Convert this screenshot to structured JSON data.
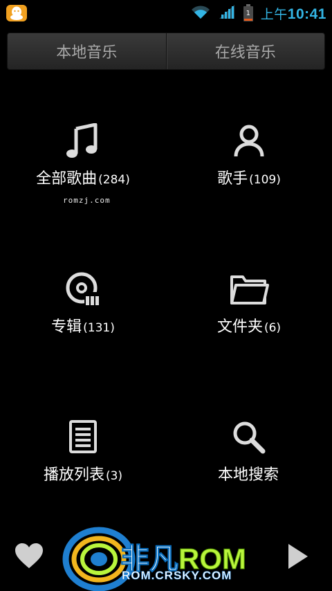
{
  "status_bar": {
    "time_ampm": "上午",
    "time": "10:41",
    "battery_level": "1",
    "icons": [
      "qq-icon",
      "wifi-icon",
      "signal-icon",
      "battery-icon"
    ]
  },
  "tabs": [
    {
      "label": "本地音乐"
    },
    {
      "label": "在线音乐"
    }
  ],
  "grid": [
    {
      "label": "全部歌曲",
      "count": "(284)",
      "icon": "music-note-icon"
    },
    {
      "label": "歌手",
      "count": "(109)",
      "icon": "person-icon"
    },
    {
      "label": "专辑",
      "count": "(131)",
      "icon": "album-icon"
    },
    {
      "label": "文件夹",
      "count": "(6)",
      "icon": "folder-icon"
    },
    {
      "label": "播放列表",
      "count": "(3)",
      "icon": "playlist-icon"
    },
    {
      "label": "本地搜索",
      "count": "",
      "icon": "search-icon"
    }
  ],
  "watermark_small": "romzj.com",
  "logo": {
    "main_cn": "非凡",
    "main_rom": "ROM",
    "sub": "ROM.CRSKY.COM"
  },
  "colors": {
    "accent": "#33b5e5",
    "background": "#000000",
    "logo_green": "#b9f53c",
    "logo_blue": "#1f7fd0"
  }
}
